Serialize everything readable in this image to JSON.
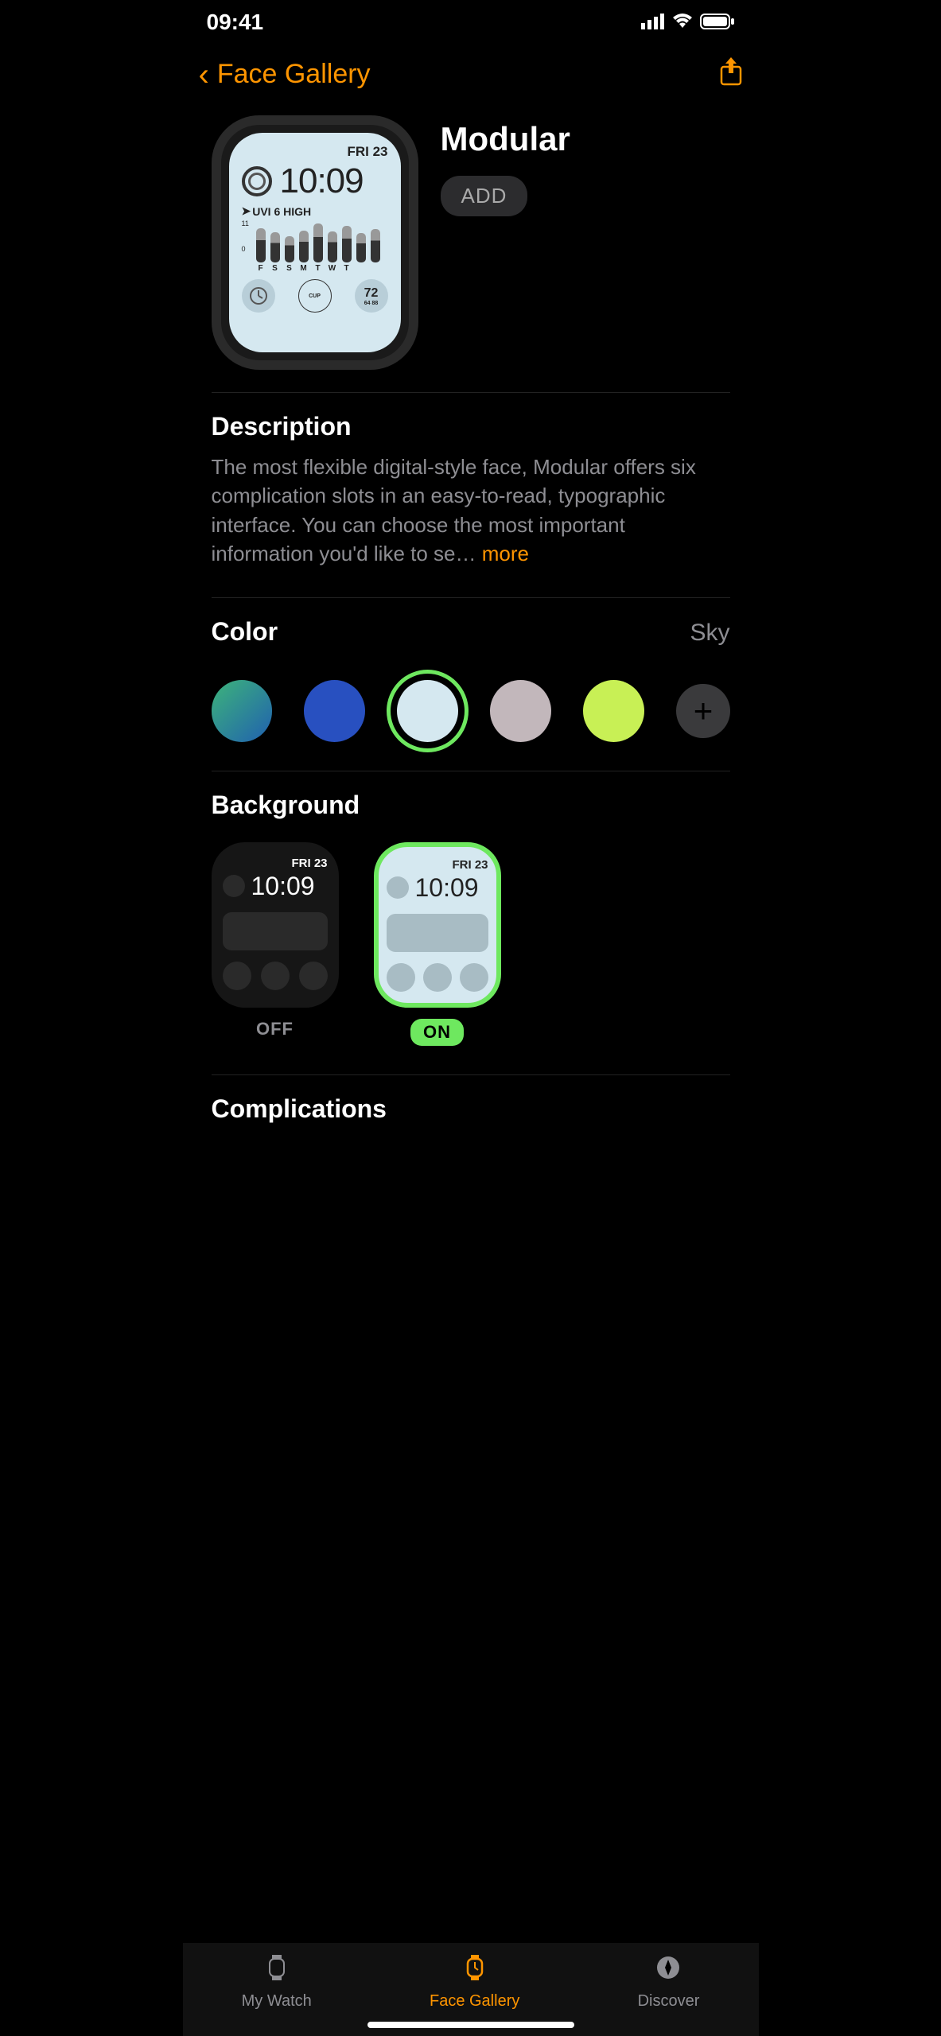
{
  "status": {
    "time": "09:41"
  },
  "nav": {
    "back_label": "Face Gallery"
  },
  "face": {
    "title": "Modular",
    "add_label": "ADD"
  },
  "preview": {
    "date": "FRI 23",
    "time": "10:09",
    "uvi": "UVI 6 HIGH",
    "chart_max": "11",
    "chart_min": "0",
    "days": [
      "F",
      "S",
      "S",
      "M",
      "T",
      "W",
      "T"
    ],
    "cup_label": "CUP",
    "aqi_value": "72",
    "aqi_range": "64  88"
  },
  "description": {
    "heading": "Description",
    "text": "The most flexible digital-style face, Modular offers six complication slots in an easy-to-read, typographic interface. You can choose the most important information you'd like to se…",
    "more": "more"
  },
  "color": {
    "heading": "Color",
    "selected_name": "Sky",
    "swatches": [
      {
        "css": "linear-gradient(135deg,#3db47a,#2060b0)"
      },
      {
        "css": "#2850c0"
      },
      {
        "css": "#d5e8f0",
        "selected": true
      },
      {
        "css": "#c2b7bb"
      },
      {
        "css": "#c8f055"
      }
    ]
  },
  "background": {
    "heading": "Background",
    "options": [
      {
        "label": "OFF",
        "style": "dark",
        "date": "FRI 23",
        "time": "10:09"
      },
      {
        "label": "ON",
        "style": "light",
        "date": "FRI 23",
        "time": "10:09",
        "selected": true
      }
    ]
  },
  "complications": {
    "heading": "Complications"
  },
  "tabs": [
    {
      "label": "My Watch",
      "icon": "watch"
    },
    {
      "label": "Face Gallery",
      "icon": "face",
      "active": true
    },
    {
      "label": "Discover",
      "icon": "compass"
    }
  ]
}
